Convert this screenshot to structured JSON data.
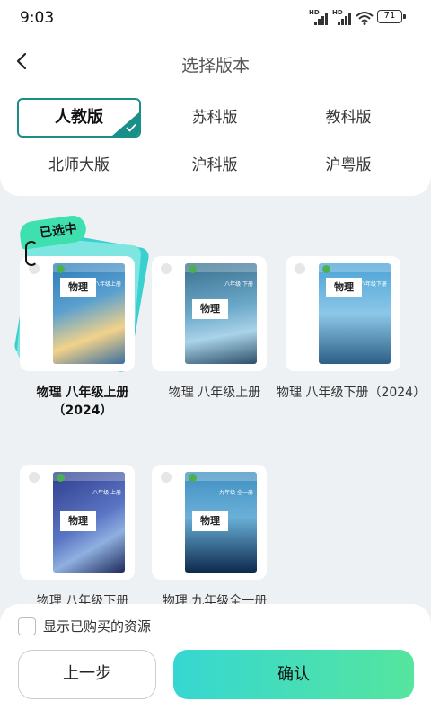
{
  "status_bar": {
    "time": "9:03",
    "hd1": "HD",
    "hd2": "HD",
    "battery": "71"
  },
  "header": {
    "title": "选择版本"
  },
  "editions": [
    {
      "label": "人教版",
      "selected": true
    },
    {
      "label": "苏科版",
      "selected": false
    },
    {
      "label": "教科版",
      "selected": false
    },
    {
      "label": "北师大版",
      "selected": false
    },
    {
      "label": "沪科版",
      "selected": false
    },
    {
      "label": "沪粤版",
      "selected": false
    }
  ],
  "selected_tag": "已选中",
  "books": [
    {
      "name": "物理 八年级上册（2024）",
      "cover_label": "物理",
      "cover_grade": "八年级上册",
      "selected": true,
      "colors": [
        "#2b7bb9",
        "#f2d28a"
      ]
    },
    {
      "name": "物理 八年级上册",
      "cover_label": "物理",
      "cover_grade": "八年级 下册",
      "selected": false,
      "colors": [
        "#3b6f8e",
        "#a9d3e8"
      ]
    },
    {
      "name": "物理 八年级下册（2024）",
      "cover_label": "物理",
      "cover_grade": "八年级下册",
      "selected": false,
      "colors": [
        "#4ba3d6",
        "#2d5f86"
      ]
    },
    {
      "name": "物理 八年级下册",
      "cover_label": "物理",
      "cover_grade": "八年级 上册",
      "selected": false,
      "colors": [
        "#2e3d8c",
        "#8fb0e0"
      ]
    },
    {
      "name": "物理 九年级全一册",
      "cover_label": "物理",
      "cover_grade": "九年级 全一册",
      "selected": false,
      "colors": [
        "#3f8fc1",
        "#0d2a4d"
      ]
    }
  ],
  "footer": {
    "show_purchased_label": "显示已购买的资源",
    "show_purchased_checked": false,
    "prev_label": "上一步",
    "confirm_label": "确认"
  },
  "colors": {
    "accent": "#1a8f8a",
    "confirm_gradient_start": "#36d7d2",
    "confirm_gradient_end": "#55e59e"
  }
}
